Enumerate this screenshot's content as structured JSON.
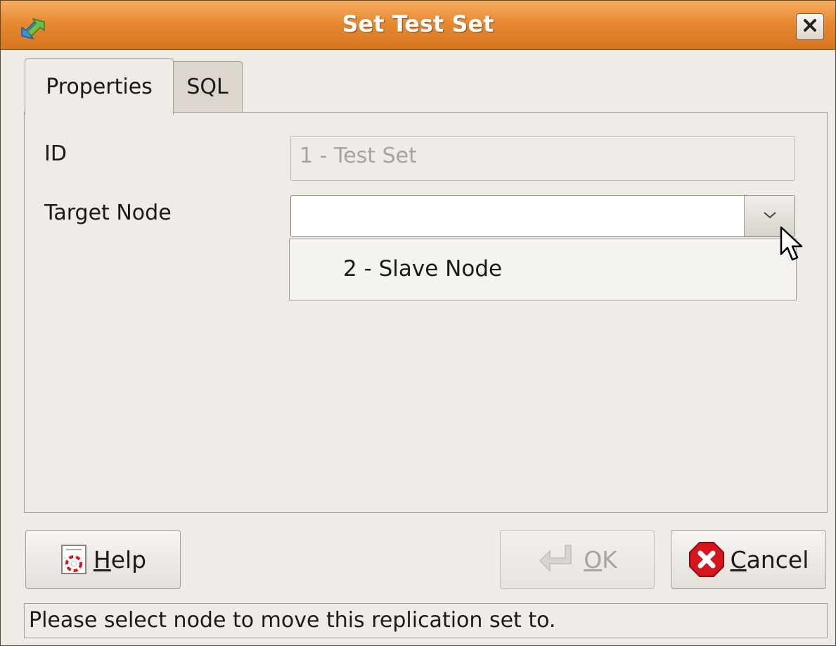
{
  "window": {
    "title": "Set Test Set",
    "close_label": "×"
  },
  "tabs": [
    {
      "label": "Properties",
      "active": true
    },
    {
      "label": "SQL",
      "active": false
    }
  ],
  "form": {
    "id_label": "ID",
    "id_value": "1 - Test Set",
    "target_label": "Target Node",
    "target_value": "",
    "dropdown_options": [
      "2 - Slave Node"
    ]
  },
  "buttons": {
    "help": {
      "mnemonic": "H",
      "rest": "elp"
    },
    "ok": {
      "mnemonic": "O",
      "rest": "K",
      "enabled": false
    },
    "cancel": {
      "mnemonic": "C",
      "rest": "ancel"
    }
  },
  "status_text": "Please select node to move this replication set to.",
  "colors": {
    "titlebar": "#e68a32",
    "background": "#efebe7",
    "cancel_icon": "#d4171d"
  }
}
